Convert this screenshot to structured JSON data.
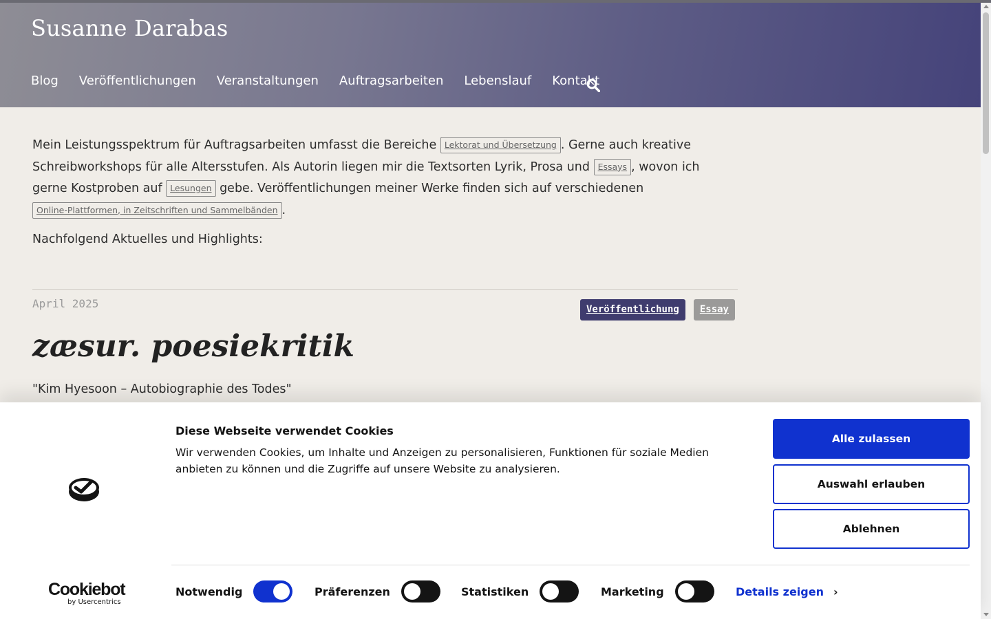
{
  "site": {
    "title": "Susanne Darabas"
  },
  "nav": {
    "items": [
      "Blog",
      "Veröffentlichungen",
      "Veranstaltungen",
      "Auftragsarbeiten",
      "Lebenslauf",
      "Kontakt"
    ]
  },
  "intro": {
    "p1": "Mein Leistungsspektrum für Auftragsarbeiten umfasst die Bereiche ",
    "tag1": "Lektorat und Übersetzung",
    "p2": ". Gerne auch kreative Schreibworkshops für alle Altersstufen. Als Autorin liegen mir die Textsorten Lyrik, Prosa und ",
    "tag2": "Essays",
    "p3": ", wovon ich gerne Kostproben auf ",
    "tag3": "Lesungen",
    "p4": " gebe. Veröffentlichungen meiner Werke finden sich auf verschiedenen ",
    "tag4": "Online-Plattformen, in Zeitschriften und Sammelbänden",
    "p5": ".",
    "after": "Nachfolgend Aktuelles und Highlights:"
  },
  "post": {
    "date": "April 2025",
    "badges": [
      "Veröffentlichung",
      "Essay"
    ],
    "title": "zæsur. poesiekritik",
    "subtitle": "\"Kim Hyesoon – Autobiographie des Todes\""
  },
  "cookie": {
    "title": "Diese Webseite verwendet Cookies",
    "text": "Wir verwenden Cookies, um Inhalte und Anzeigen zu personalisieren, Funktionen für soziale Medien anbieten zu können und die Zugriffe auf unsere Website zu analysieren.",
    "buttons": {
      "allow_all": "Alle zulassen",
      "allow_selection": "Auswahl erlauben",
      "reject": "Ablehnen"
    },
    "toggles": [
      {
        "label": "Notwendig",
        "on": true
      },
      {
        "label": "Präferenzen",
        "on": false
      },
      {
        "label": "Statistiken",
        "on": false
      },
      {
        "label": "Marketing",
        "on": false
      }
    ],
    "details": "Details zeigen",
    "brand": {
      "name": "Cookiebot",
      "by": "by Usercentrics"
    }
  },
  "colors": {
    "accent": "#1032cf",
    "badge_pub": "#3f3c6e",
    "badge_essay": "#9b9a99"
  }
}
